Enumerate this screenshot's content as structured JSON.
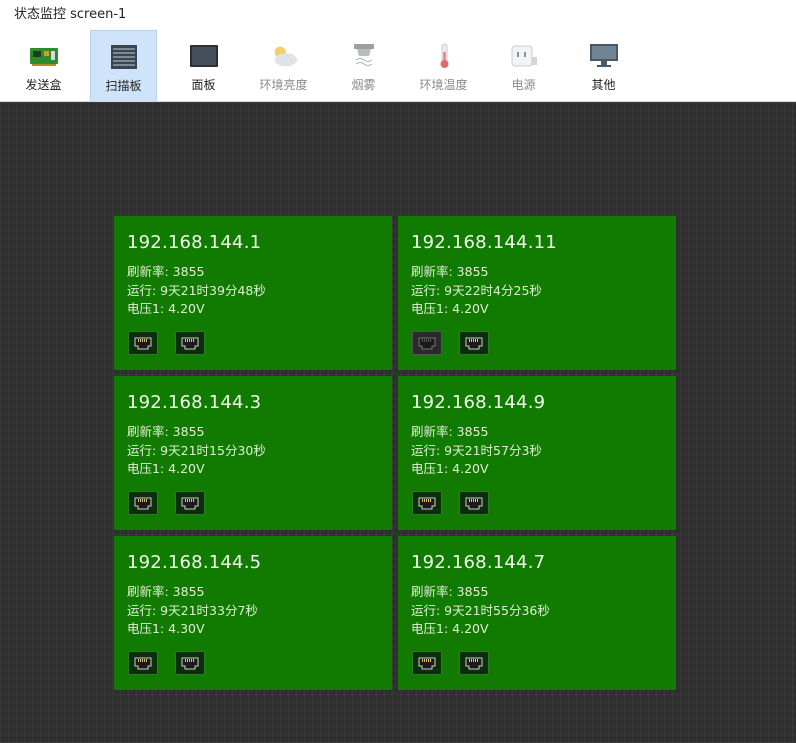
{
  "window": {
    "title": "状态监控 screen-1"
  },
  "toolbar": {
    "items": [
      {
        "label": "发送盒",
        "icon": "sender-box-icon",
        "state": "normal"
      },
      {
        "label": "扫描板",
        "icon": "scan-card-icon",
        "state": "active"
      },
      {
        "label": "面板",
        "icon": "panel-icon",
        "state": "normal"
      },
      {
        "label": "环境亮度",
        "icon": "weather-icon",
        "state": "disabled"
      },
      {
        "label": "烟雾",
        "icon": "smoke-detector-icon",
        "state": "disabled"
      },
      {
        "label": "环境温度",
        "icon": "thermometer-icon",
        "state": "disabled"
      },
      {
        "label": "电源",
        "icon": "power-outlet-icon",
        "state": "disabled"
      },
      {
        "label": "其他",
        "icon": "monitor-icon",
        "state": "normal"
      }
    ]
  },
  "cards": [
    {
      "ip": "192.168.144.1",
      "refresh": "刷新率: 3855",
      "uptime": "运行: 9天21时39分48秒",
      "voltage": "电压1: 4.20V",
      "ports": [
        "connected",
        "connected"
      ]
    },
    {
      "ip": "192.168.144.11",
      "refresh": "刷新率: 3855",
      "uptime": "运行: 9天22时4分25秒",
      "voltage": "电压1: 4.20V",
      "ports": [
        "disconnected",
        "connected"
      ]
    },
    {
      "ip": "192.168.144.3",
      "refresh": "刷新率: 3855",
      "uptime": "运行: 9天21时15分30秒",
      "voltage": "电压1: 4.20V",
      "ports": [
        "connected",
        "connected"
      ]
    },
    {
      "ip": "192.168.144.9",
      "refresh": "刷新率: 3855",
      "uptime": "运行: 9天21时57分3秒",
      "voltage": "电压1: 4.20V",
      "ports": [
        "connected",
        "connected"
      ]
    },
    {
      "ip": "192.168.144.5",
      "refresh": "刷新率: 3855",
      "uptime": "运行: 9天21时33分7秒",
      "voltage": "电压1: 4.30V",
      "ports": [
        "connected",
        "connected"
      ]
    },
    {
      "ip": "192.168.144.7",
      "refresh": "刷新率: 3855",
      "uptime": "运行: 9天21时55分36秒",
      "voltage": "电压1: 4.20V",
      "ports": [
        "connected",
        "connected"
      ]
    }
  ],
  "colors": {
    "card_ok": "#117a00",
    "canvas_bg": "#2f2f2f",
    "active_tab": "#cfe3fa"
  }
}
